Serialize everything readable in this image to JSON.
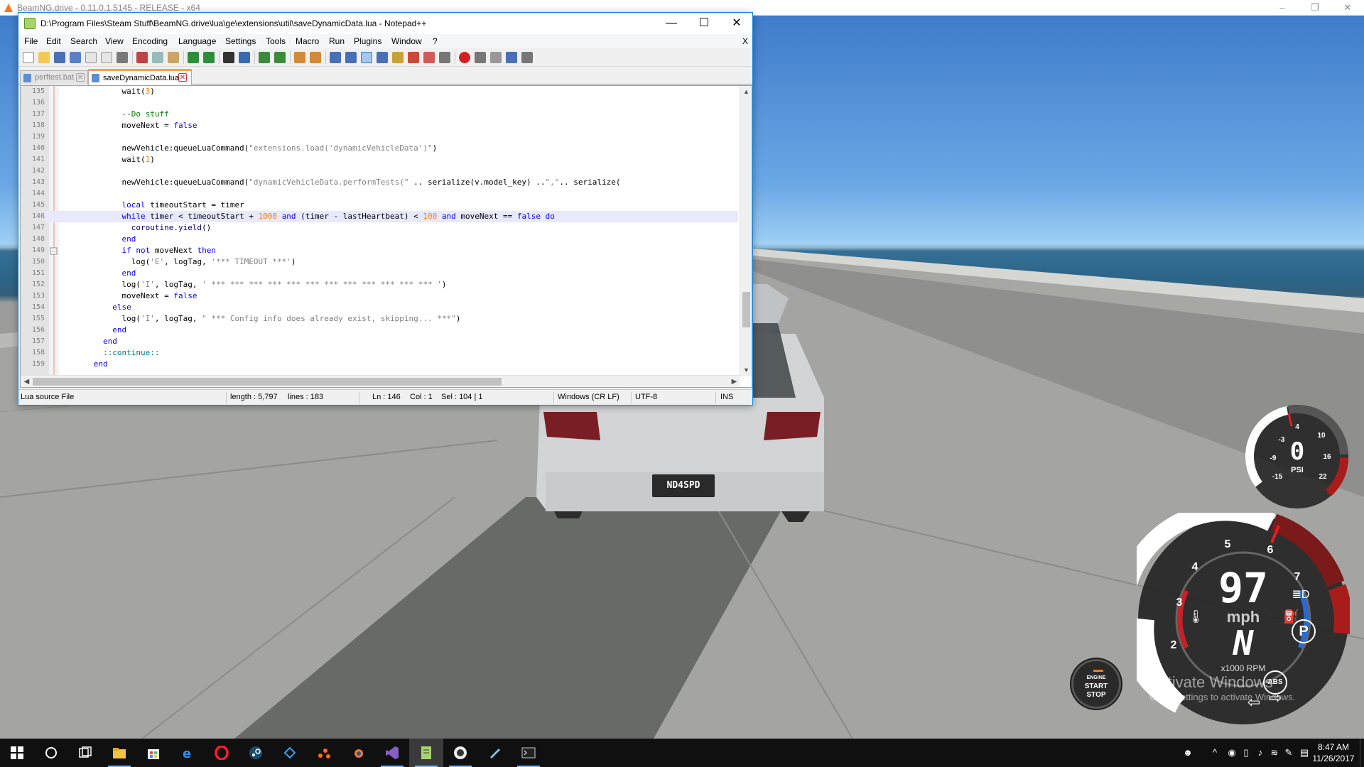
{
  "game_window": {
    "title": "BeamNG.drive - 0.11.0.1.5145 - RELEASE - x64",
    "minimize": "–",
    "restore": "❐",
    "close": "✕"
  },
  "npp": {
    "title": "D:\\Program Files\\Steam Stuff\\BeamNG.drive\\lua\\ge\\extensions\\util\\saveDynamicData.lua - Notepad++",
    "window_buttons": {
      "minimize": "—",
      "maximize": "☐",
      "close": "✕"
    },
    "menu": [
      "File",
      "Edit",
      "Search",
      "View",
      "Encoding",
      "Language",
      "Settings",
      "Tools",
      "Macro",
      "Run",
      "Plugins",
      "Window",
      "?"
    ],
    "menu_close": "X",
    "tabs": [
      {
        "label": "perftest.bat",
        "active": false
      },
      {
        "label": "saveDynamicData.lua",
        "active": true
      }
    ],
    "tab_close": "✕",
    "lines": [
      {
        "n": "135",
        "html": "            wait(<span class=\"nu\">3</span>)"
      },
      {
        "n": "136",
        "html": ""
      },
      {
        "n": "137",
        "html": "            <span class=\"cm\">--Do stuff</span>"
      },
      {
        "n": "138",
        "html": "            moveNext = <span class=\"kw\">false</span>"
      },
      {
        "n": "139",
        "html": ""
      },
      {
        "n": "140",
        "html": "            newVehicle:queueLuaCommand(<span class=\"st\">\"extensions.load('dynamicVehicleData')\"</span>)"
      },
      {
        "n": "141",
        "html": "            wait(<span class=\"nu\">1</span>)"
      },
      {
        "n": "142",
        "html": ""
      },
      {
        "n": "143",
        "html": "            newVehicle:queueLuaCommand(<span class=\"st\">\"dynamicVehicleData.performTests(\"</span> .. serialize(v.model_key) ..<span class=\"st\">\",\"</span>.. serialize("
      },
      {
        "n": "144",
        "html": ""
      },
      {
        "n": "145",
        "html": "            <span class=\"kw\">local</span> timeoutStart = timer"
      },
      {
        "n": "146",
        "html": "            <span class=\"kw\">while</span> timer &lt; timeoutStart + <span class=\"nu\">1000</span> <span class=\"kw\">and</span> (timer - lastHeartbeat) &lt; <span class=\"nu\">100</span> <span class=\"kw\">and</span> moveNext == <span class=\"kw\">false</span> <span class=\"kw\">do</span>"
      },
      {
        "n": "147",
        "html": "              <span class=\"fn\">coroutine.yield</span>()"
      },
      {
        "n": "148",
        "html": "            <span class=\"kw\">end</span>"
      },
      {
        "n": "149",
        "html": "            <span class=\"kw\">if</span> <span class=\"kw\">not</span> moveNext <span class=\"kw\">then</span>"
      },
      {
        "n": "150",
        "html": "              log(<span class=\"st\">'E'</span>, logTag, <span class=\"st\">'*** TIMEOUT ***'</span>)"
      },
      {
        "n": "151",
        "html": "            <span class=\"kw\">end</span>"
      },
      {
        "n": "152",
        "html": "            log(<span class=\"st\">'I'</span>, logTag, <span class=\"st\">' *** *** *** *** *** *** *** *** *** *** *** *** '</span>)"
      },
      {
        "n": "153",
        "html": "            moveNext = <span class=\"kw\">false</span>"
      },
      {
        "n": "154",
        "html": "          <span class=\"kw\">else</span>"
      },
      {
        "n": "155",
        "html": "            log(<span class=\"st\">'I'</span>, logTag, <span class=\"st\">\" *** Config info does already exist, skipping... ***\"</span>)"
      },
      {
        "n": "156",
        "html": "          <span class=\"kw\">end</span>"
      },
      {
        "n": "157",
        "html": "        <span class=\"kw\">end</span>"
      },
      {
        "n": "158",
        "html": "        <span class=\"lb\">::continue::</span>"
      },
      {
        "n": "159",
        "html": "      <span class=\"kw\">end</span>"
      }
    ],
    "status": {
      "type": "Lua source File",
      "length": "length : 5,797",
      "lines": "lines : 183",
      "ln": "Ln : 146",
      "col": "Col : 1",
      "sel": "Sel : 104 | 1",
      "eol": "Windows (CR LF)",
      "encoding": "UTF-8",
      "mode": "INS"
    }
  },
  "car": {
    "plate": "ND4SPD"
  },
  "hud": {
    "boost": {
      "value": "0",
      "unit": "PSI",
      "ticks": [
        "-3",
        "4",
        "10",
        "-9",
        "16",
        "-15",
        "22"
      ]
    },
    "speed": {
      "value": "97",
      "unit": "mph",
      "gear": "N",
      "rpm_label": "x1000 RPM",
      "ticks": [
        "2",
        "3",
        "4",
        "5",
        "6",
        "7"
      ]
    },
    "engine_button": [
      "ENGINE",
      "START",
      "STOP"
    ],
    "parking": "P",
    "abs": "ABS"
  },
  "watermark": {
    "line1": "Activate Windows",
    "line2": "Go to Settings to activate Windows."
  },
  "taskbar": {
    "apps": [
      "start-icon",
      "cortana-icon",
      "task-view-icon",
      "file-explorer-icon",
      "store-icon",
      "edge-icon",
      "opera-icon",
      "steam-icon",
      "blender-helper-icon",
      "app-orange-icon",
      "blender-icon",
      "visual-studio-icon",
      "notepadpp-icon",
      "beamng-icon",
      "notes-icon",
      "terminal-icon"
    ],
    "time": "8:47 AM",
    "date": "11/26/2017"
  }
}
